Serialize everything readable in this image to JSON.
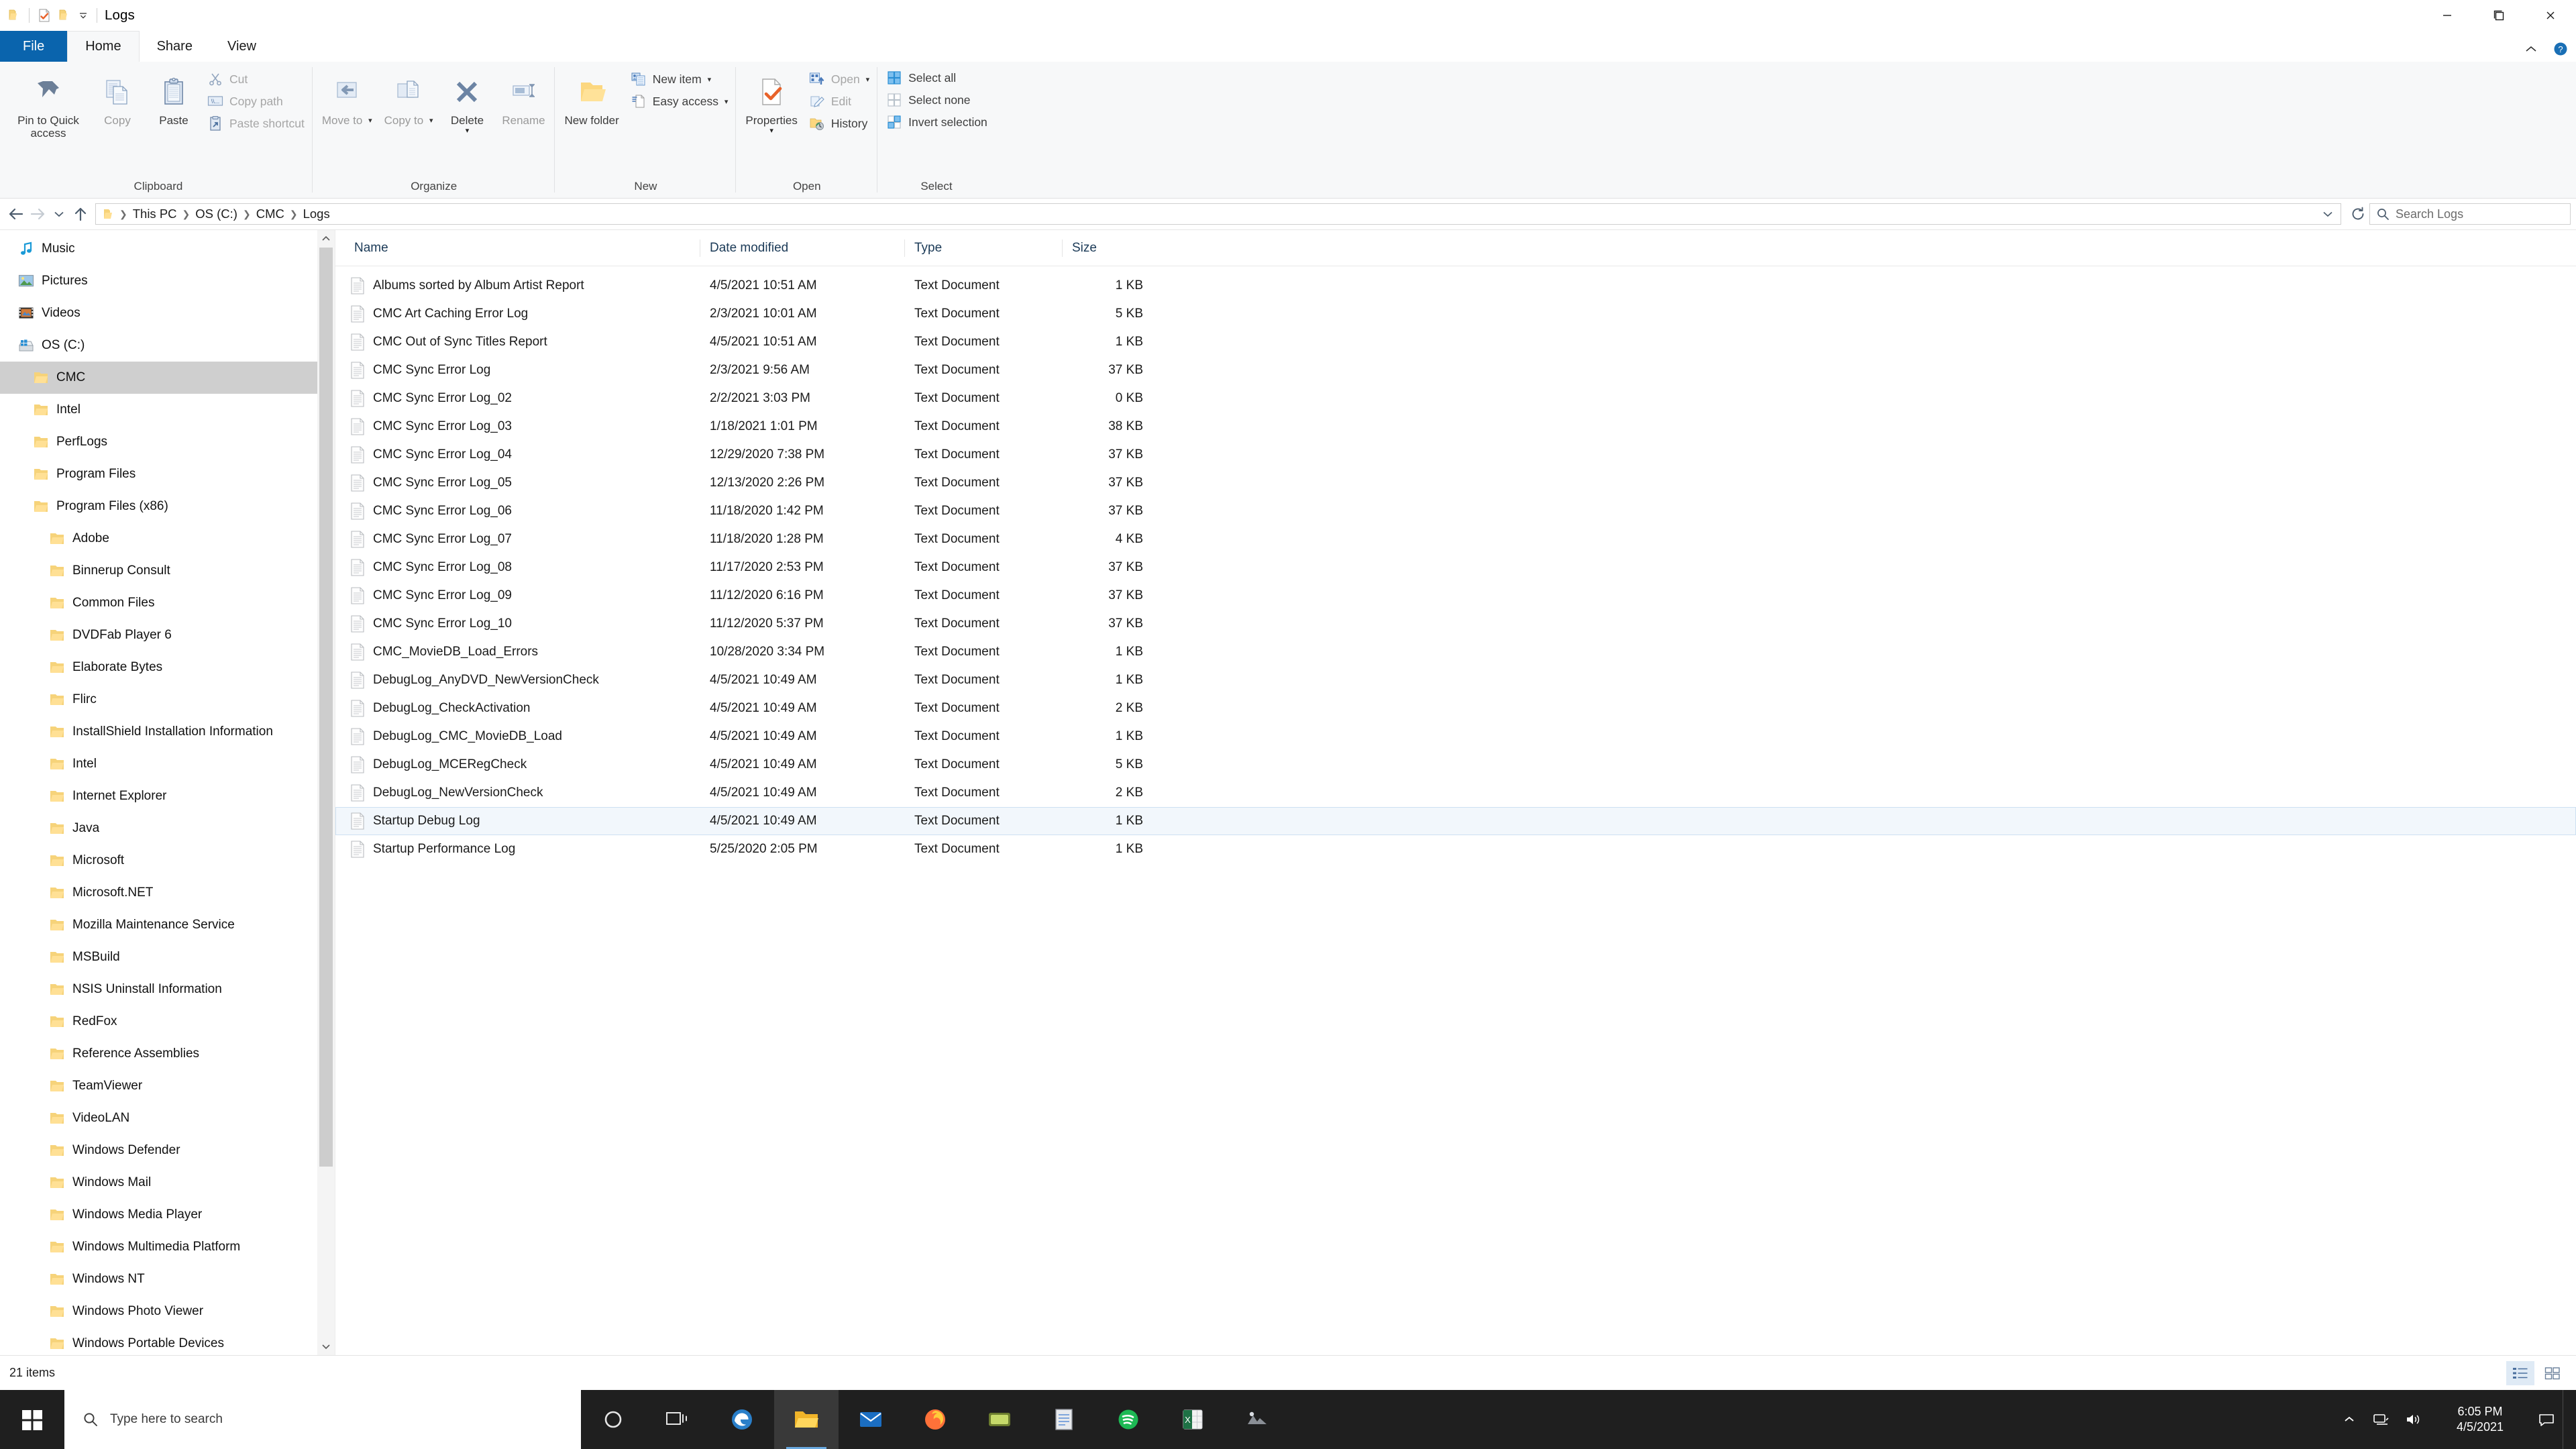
{
  "window": {
    "title": "Logs",
    "quick_access_icons": [
      "folder-icon",
      "properties-check-icon",
      "new-folder-icon"
    ],
    "caption": {
      "minimize": "minimize-icon",
      "maximize": "maximize-icon",
      "close": "close-icon"
    }
  },
  "ribbon": {
    "tabs": [
      {
        "label": "File",
        "id": "file"
      },
      {
        "label": "Home",
        "id": "home"
      },
      {
        "label": "Share",
        "id": "share"
      },
      {
        "label": "View",
        "id": "view"
      }
    ],
    "active_tab": "Home",
    "right_buttons": [
      "collapse-ribbon-icon",
      "help-icon"
    ],
    "groups": [
      {
        "label": "Clipboard",
        "big_buttons": [
          {
            "label": "Pin to Quick access",
            "icon": "pin-icon",
            "dim": false,
            "caret": false
          },
          {
            "label": "Copy",
            "icon": "copy-icon",
            "dim": true,
            "caret": false
          },
          {
            "label": "Paste",
            "icon": "paste-icon",
            "dim": false,
            "caret": false
          }
        ],
        "small_buttons": [
          {
            "label": "Cut",
            "icon": "scissors-icon",
            "dim": true
          },
          {
            "label": "Copy path",
            "icon": "copy-path-icon",
            "dim": true
          },
          {
            "label": "Paste shortcut",
            "icon": "paste-shortcut-icon",
            "dim": true
          }
        ]
      },
      {
        "label": "Organize",
        "big_buttons": [
          {
            "label": "Move to",
            "icon": "move-to-icon",
            "dim": true,
            "caret": true
          },
          {
            "label": "Copy to",
            "icon": "copy-to-icon",
            "dim": true,
            "caret": true
          },
          {
            "label": "Delete",
            "icon": "delete-x-icon",
            "dim": false,
            "caret": true
          },
          {
            "label": "Rename",
            "icon": "rename-icon",
            "dim": true,
            "caret": false
          }
        ],
        "small_buttons": []
      },
      {
        "label": "New",
        "big_buttons": [
          {
            "label": "New folder",
            "icon": "new-folder-icon",
            "dim": false,
            "caret": false
          }
        ],
        "small_buttons": [
          {
            "label": "New item",
            "icon": "new-item-icon",
            "dim": false,
            "caret": true
          },
          {
            "label": "Easy access",
            "icon": "easy-access-icon",
            "dim": false,
            "caret": true
          }
        ]
      },
      {
        "label": "Open",
        "big_buttons": [
          {
            "label": "Properties",
            "icon": "properties-check-icon",
            "dim": false,
            "caret": true
          }
        ],
        "small_buttons": [
          {
            "label": "Open",
            "icon": "open-icon",
            "dim": true,
            "caret": true
          },
          {
            "label": "Edit",
            "icon": "edit-icon",
            "dim": true
          },
          {
            "label": "History",
            "icon": "history-icon",
            "dim": false
          }
        ]
      },
      {
        "label": "Select",
        "big_buttons": [],
        "small_buttons": [
          {
            "label": "Select all",
            "icon": "select-all-icon",
            "dim": false
          },
          {
            "label": "Select none",
            "icon": "select-none-icon",
            "dim": false
          },
          {
            "label": "Invert selection",
            "icon": "invert-selection-icon",
            "dim": false
          }
        ]
      }
    ]
  },
  "address_bar": {
    "back": "back-arrow-icon",
    "forward": "forward-arrow-icon",
    "recent": "recent-locations-chevron-icon",
    "up": "up-arrow-icon",
    "crumbs": [
      "This PC",
      "OS (C:)",
      "CMC",
      "Logs"
    ],
    "dropdown": "address-dropdown-icon",
    "refresh": "refresh-icon",
    "search_placeholder": "Search Logs",
    "search_value": ""
  },
  "nav_pane": {
    "items": [
      {
        "label": "Music",
        "icon": "music-icon",
        "indent": 1,
        "selected": false
      },
      {
        "label": "Pictures",
        "icon": "pictures-icon",
        "indent": 1,
        "selected": false
      },
      {
        "label": "Videos",
        "icon": "videos-icon",
        "indent": 1,
        "selected": false
      },
      {
        "label": "OS (C:)",
        "icon": "drive-icon",
        "indent": 1,
        "selected": false
      },
      {
        "label": "CMC",
        "icon": "folder-icon",
        "indent": 2,
        "selected": true
      },
      {
        "label": "Intel",
        "icon": "folder-icon",
        "indent": 2,
        "selected": false
      },
      {
        "label": "PerfLogs",
        "icon": "folder-icon",
        "indent": 2,
        "selected": false
      },
      {
        "label": "Program Files",
        "icon": "folder-icon",
        "indent": 2,
        "selected": false
      },
      {
        "label": "Program Files (x86)",
        "icon": "folder-icon",
        "indent": 2,
        "selected": false
      },
      {
        "label": "Adobe",
        "icon": "folder-icon",
        "indent": 3,
        "selected": false
      },
      {
        "label": "Binnerup Consult",
        "icon": "folder-icon",
        "indent": 3,
        "selected": false
      },
      {
        "label": "Common Files",
        "icon": "folder-icon",
        "indent": 3,
        "selected": false
      },
      {
        "label": "DVDFab Player 6",
        "icon": "folder-icon",
        "indent": 3,
        "selected": false
      },
      {
        "label": "Elaborate Bytes",
        "icon": "folder-icon",
        "indent": 3,
        "selected": false
      },
      {
        "label": "Flirc",
        "icon": "folder-icon",
        "indent": 3,
        "selected": false
      },
      {
        "label": "InstallShield Installation Information",
        "icon": "folder-icon",
        "indent": 3,
        "selected": false
      },
      {
        "label": "Intel",
        "icon": "folder-icon",
        "indent": 3,
        "selected": false
      },
      {
        "label": "Internet Explorer",
        "icon": "folder-icon",
        "indent": 3,
        "selected": false
      },
      {
        "label": "Java",
        "icon": "folder-icon",
        "indent": 3,
        "selected": false
      },
      {
        "label": "Microsoft",
        "icon": "folder-icon",
        "indent": 3,
        "selected": false
      },
      {
        "label": "Microsoft.NET",
        "icon": "folder-icon",
        "indent": 3,
        "selected": false
      },
      {
        "label": "Mozilla Maintenance Service",
        "icon": "folder-icon",
        "indent": 3,
        "selected": false
      },
      {
        "label": "MSBuild",
        "icon": "folder-icon",
        "indent": 3,
        "selected": false
      },
      {
        "label": "NSIS Uninstall Information",
        "icon": "folder-icon",
        "indent": 3,
        "selected": false
      },
      {
        "label": "RedFox",
        "icon": "folder-icon",
        "indent": 3,
        "selected": false
      },
      {
        "label": "Reference Assemblies",
        "icon": "folder-icon",
        "indent": 3,
        "selected": false
      },
      {
        "label": "TeamViewer",
        "icon": "folder-icon",
        "indent": 3,
        "selected": false
      },
      {
        "label": "VideoLAN",
        "icon": "folder-icon",
        "indent": 3,
        "selected": false
      },
      {
        "label": "Windows Defender",
        "icon": "folder-icon",
        "indent": 3,
        "selected": false
      },
      {
        "label": "Windows Mail",
        "icon": "folder-icon",
        "indent": 3,
        "selected": false
      },
      {
        "label": "Windows Media Player",
        "icon": "folder-icon",
        "indent": 3,
        "selected": false
      },
      {
        "label": "Windows Multimedia Platform",
        "icon": "folder-icon",
        "indent": 3,
        "selected": false
      },
      {
        "label": "Windows NT",
        "icon": "folder-icon",
        "indent": 3,
        "selected": false
      },
      {
        "label": "Windows Photo Viewer",
        "icon": "folder-icon",
        "indent": 3,
        "selected": false
      },
      {
        "label": "Windows Portable Devices",
        "icon": "folder-icon",
        "indent": 3,
        "selected": false
      }
    ]
  },
  "file_list": {
    "columns": [
      "Name",
      "Date modified",
      "Type",
      "Size"
    ],
    "sort_column": "Name",
    "sort_direction": "ascending",
    "rows": [
      {
        "name": "Albums sorted by Album Artist Report",
        "date": "4/5/2021 10:51 AM",
        "type": "Text Document",
        "size": "1 KB",
        "selected": false
      },
      {
        "name": "CMC Art Caching Error Log",
        "date": "2/3/2021 10:01 AM",
        "type": "Text Document",
        "size": "5 KB",
        "selected": false
      },
      {
        "name": "CMC Out of Sync Titles Report",
        "date": "4/5/2021 10:51 AM",
        "type": "Text Document",
        "size": "1 KB",
        "selected": false
      },
      {
        "name": "CMC Sync Error Log",
        "date": "2/3/2021 9:56 AM",
        "type": "Text Document",
        "size": "37 KB",
        "selected": false
      },
      {
        "name": "CMC Sync Error Log_02",
        "date": "2/2/2021 3:03 PM",
        "type": "Text Document",
        "size": "0 KB",
        "selected": false
      },
      {
        "name": "CMC Sync Error Log_03",
        "date": "1/18/2021 1:01 PM",
        "type": "Text Document",
        "size": "38 KB",
        "selected": false
      },
      {
        "name": "CMC Sync Error Log_04",
        "date": "12/29/2020 7:38 PM",
        "type": "Text Document",
        "size": "37 KB",
        "selected": false
      },
      {
        "name": "CMC Sync Error Log_05",
        "date": "12/13/2020 2:26 PM",
        "type": "Text Document",
        "size": "37 KB",
        "selected": false
      },
      {
        "name": "CMC Sync Error Log_06",
        "date": "11/18/2020 1:42 PM",
        "type": "Text Document",
        "size": "37 KB",
        "selected": false
      },
      {
        "name": "CMC Sync Error Log_07",
        "date": "11/18/2020 1:28 PM",
        "type": "Text Document",
        "size": "4 KB",
        "selected": false
      },
      {
        "name": "CMC Sync Error Log_08",
        "date": "11/17/2020 2:53 PM",
        "type": "Text Document",
        "size": "37 KB",
        "selected": false
      },
      {
        "name": "CMC Sync Error Log_09",
        "date": "11/12/2020 6:16 PM",
        "type": "Text Document",
        "size": "37 KB",
        "selected": false
      },
      {
        "name": "CMC Sync Error Log_10",
        "date": "11/12/2020 5:37 PM",
        "type": "Text Document",
        "size": "37 KB",
        "selected": false
      },
      {
        "name": "CMC_MovieDB_Load_Errors",
        "date": "10/28/2020 3:34 PM",
        "type": "Text Document",
        "size": "1 KB",
        "selected": false
      },
      {
        "name": "DebugLog_AnyDVD_NewVersionCheck",
        "date": "4/5/2021 10:49 AM",
        "type": "Text Document",
        "size": "1 KB",
        "selected": false
      },
      {
        "name": "DebugLog_CheckActivation",
        "date": "4/5/2021 10:49 AM",
        "type": "Text Document",
        "size": "2 KB",
        "selected": false
      },
      {
        "name": "DebugLog_CMC_MovieDB_Load",
        "date": "4/5/2021 10:49 AM",
        "type": "Text Document",
        "size": "1 KB",
        "selected": false
      },
      {
        "name": "DebugLog_MCERegCheck",
        "date": "4/5/2021 10:49 AM",
        "type": "Text Document",
        "size": "5 KB",
        "selected": false
      },
      {
        "name": "DebugLog_NewVersionCheck",
        "date": "4/5/2021 10:49 AM",
        "type": "Text Document",
        "size": "2 KB",
        "selected": false
      },
      {
        "name": "Startup Debug Log",
        "date": "4/5/2021 10:49 AM",
        "type": "Text Document",
        "size": "1 KB",
        "selected": true
      },
      {
        "name": "Startup Performance Log",
        "date": "5/25/2020 2:05 PM",
        "type": "Text Document",
        "size": "1 KB",
        "selected": false
      }
    ]
  },
  "status_bar": {
    "item_count": "21 items",
    "view_buttons": [
      "details-view-icon",
      "large-icons-view-icon"
    ],
    "active_view": "details-view-icon"
  },
  "taskbar": {
    "start": "windows-start-icon",
    "search_placeholder": "Type here to search",
    "buttons": [
      {
        "name": "cortana-icon"
      },
      {
        "name": "task-view-icon"
      },
      {
        "name": "edge-icon"
      },
      {
        "name": "file-explorer-icon"
      },
      {
        "name": "mail-icon"
      },
      {
        "name": "firefox-icon"
      },
      {
        "name": "media-center-icon"
      },
      {
        "name": "notepad-icon"
      },
      {
        "name": "spotify-icon"
      },
      {
        "name": "excel-icon"
      },
      {
        "name": "app-icon"
      }
    ],
    "tray": [
      "show-hidden-icons-chevron",
      "network-icon",
      "volume-icon",
      "action-center-icon"
    ],
    "clock": {
      "time": "6:05 PM",
      "date": "4/5/2021"
    }
  },
  "colors": {
    "accent": "#0a64ad",
    "selection": "#cfcfcf",
    "row_selection": "#f2f7fc",
    "taskbar": "#1f1f1f",
    "column_header_text": "#1b3a57"
  }
}
